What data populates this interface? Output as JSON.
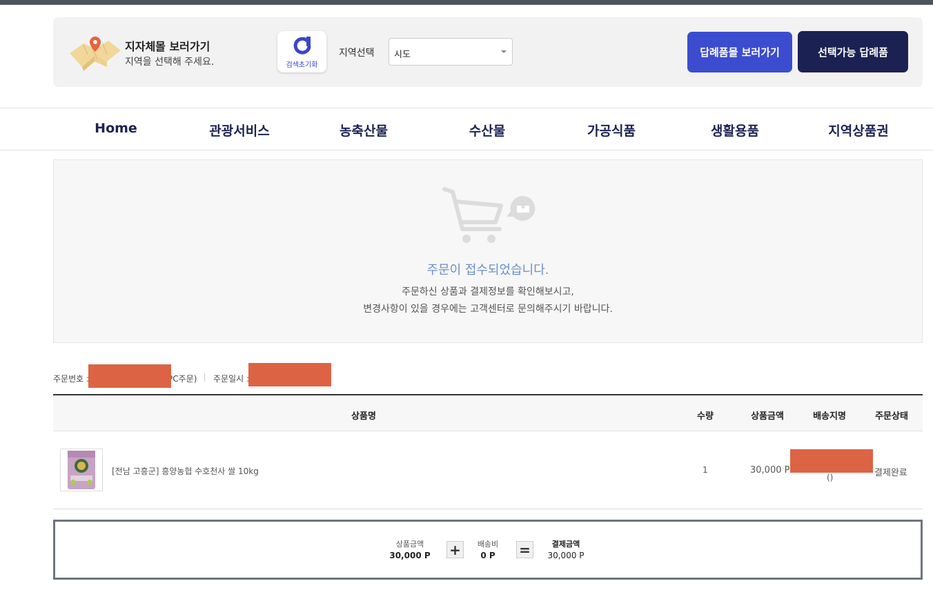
{
  "colors": {
    "primary": "#3b4ccf",
    "navy": "#1b2253",
    "notice_text": "#6d8fc8",
    "redaction": "#dc6444"
  },
  "region": {
    "title": "지자체몰 보러가기",
    "subtitle": "지역을 선택해 주세요.",
    "reset_label": "검색초기화",
    "select_label": "지역선택",
    "select_value": "시도",
    "gift_mall_button": "답례품몰 보러가기",
    "selectable_button": "선택가능 답례품"
  },
  "nav": {
    "items": [
      "Home",
      "관광서비스",
      "농축산물",
      "수산물",
      "가공식품",
      "생활용품",
      "지역상품권"
    ]
  },
  "notice": {
    "title": "주문이 접수되었습니다.",
    "line1": "주문하신 상품과 결제정보를 확인해보시고,",
    "line2": "변경사항이 있을 경우에는 고객센터로 문의해주시기 바랍니다."
  },
  "order": {
    "number_label": "주문번호 :",
    "channel_suffix": "PC주문)",
    "date_label": "주문일시 :"
  },
  "table": {
    "headers": [
      "상품명",
      "수량",
      "상품금액",
      "배송지명",
      "주문상태"
    ],
    "rows": [
      {
        "product": "[전남 고흥군] 흥양농협 수호천사 쌀 10kg",
        "qty": "1",
        "price": "30,000 P",
        "recipient_suffix": "()",
        "status": "결제완료"
      }
    ]
  },
  "summary": {
    "goods_label": "상품금액",
    "goods_value": "30,000 P",
    "plus_op": "+",
    "shipping_label": "배송비",
    "shipping_value": "0 P",
    "equals_op": "=",
    "total_label": "결제금액",
    "total_value": "30,000 P"
  }
}
